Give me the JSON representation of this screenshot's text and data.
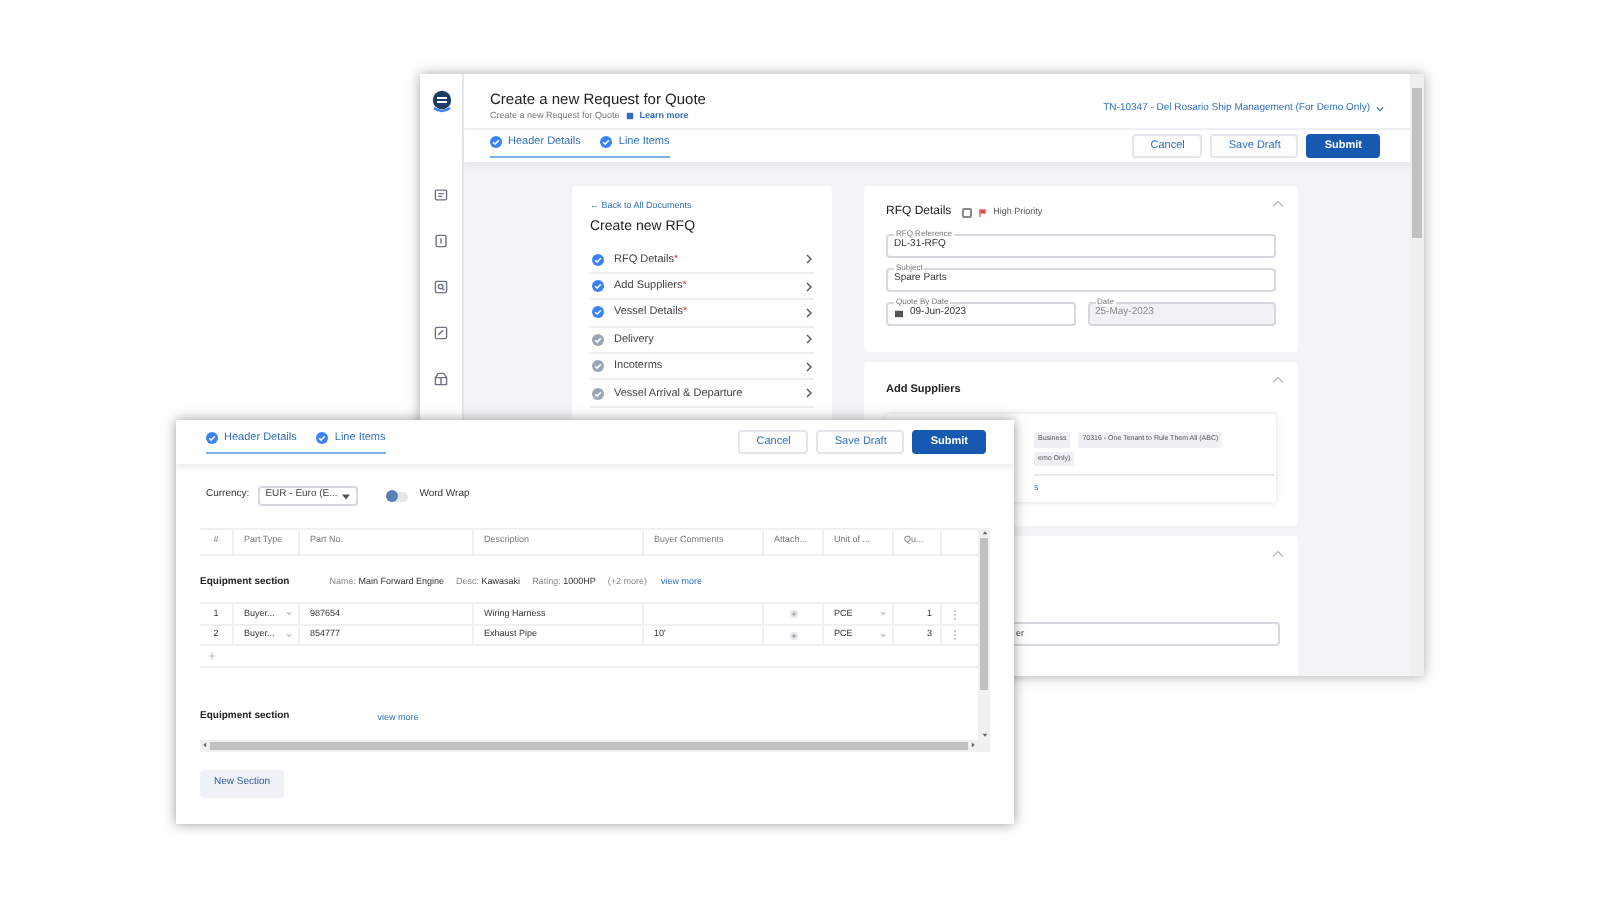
{
  "back_window": {
    "title": "Create a new Request for Quote",
    "subtitle": "Create a new Request for Quote",
    "learn_more": "Learn more",
    "account": "TN-10347 - Del Rosario Ship Management (For Demo Only)",
    "tabs": [
      {
        "label": "Header Details",
        "completed": true
      },
      {
        "label": "Line Items",
        "completed": true
      }
    ],
    "buttons": [
      {
        "label": "Cancel",
        "kind": "secondary"
      },
      {
        "label": "Save Draft",
        "kind": "secondary"
      },
      {
        "label": "Submit",
        "kind": "primary"
      }
    ],
    "steps_card": {
      "back_link": "← Back to All Documents",
      "title": "Create new RFQ",
      "steps": [
        {
          "label": "RFQ Details",
          "required_mark": "*",
          "completed": true
        },
        {
          "label": "Add Suppliers",
          "required_mark": "*",
          "completed": true
        },
        {
          "label": "Vessel Details",
          "required_mark": "*",
          "completed": true
        },
        {
          "label": "Delivery",
          "completed": false
        },
        {
          "label": "Incoterms",
          "completed": false
        },
        {
          "label": "Vessel Arrival & Departure",
          "completed": false
        }
      ]
    },
    "rfq_card": {
      "title": "RFQ Details",
      "high_priority": {
        "label": "High Priority",
        "checked": false
      },
      "fields": [
        {
          "label": "RFQ Reference",
          "value": "DL-31-RFQ",
          "kind": "text",
          "disabled": false
        },
        {
          "label": "Subject",
          "value": "Spare Parts",
          "kind": "text",
          "disabled": false
        },
        {
          "label": "Quote By Date",
          "value": "09-Jun-2023",
          "kind": "date",
          "disabled": false
        },
        {
          "label": "Date",
          "value": "25-May-2023",
          "kind": "text",
          "disabled": true
        }
      ]
    },
    "suppliers_card": {
      "title": "Add Suppliers",
      "chips": [
        "Business",
        "70316 - One Tenant to Rule Them All (ABC)"
      ],
      "chip_2": "emo Only)",
      "link": "s"
    },
    "third_card": {
      "field_value": "er"
    }
  },
  "front_window": {
    "tabs": [
      {
        "label": "Header Details",
        "completed": true
      },
      {
        "label": "Line Items",
        "completed": true
      }
    ],
    "buttons": [
      {
        "label": "Cancel",
        "kind": "secondary"
      },
      {
        "label": "Save Draft",
        "kind": "secondary"
      },
      {
        "label": "Submit",
        "kind": "primary"
      }
    ],
    "currency": {
      "label": "Currency:",
      "value": "EUR - Euro (E..."
    },
    "word_wrap": {
      "label": "Word Wrap",
      "on": false
    },
    "columns": [
      "#",
      "Part Type",
      "Part No.",
      "Description",
      "Buyer Comments",
      "Attach...",
      "Unit of ...",
      "Qu..."
    ],
    "sections": [
      {
        "title": "Equipment section",
        "meta": [
          {
            "label": "Name:",
            "value": "Main Forward Engine"
          },
          {
            "label": "Desc:",
            "value": "Kawasaki"
          },
          {
            "label": "Rating:",
            "value": "1000HP"
          }
        ],
        "more": "(+2 more)",
        "link": "view more",
        "rows": [
          {
            "cells": [
              "1",
              "Buyer...",
              "987654",
              "Wiring Harness",
              "",
              "",
              "PCE",
              "1"
            ]
          },
          {
            "cells": [
              "2",
              "Buyer...",
              "854777",
              "Exhaust Pipe",
              "10'",
              "",
              "PCE",
              "3"
            ]
          }
        ]
      },
      {
        "title": "Equipment section",
        "link": "view more"
      }
    ],
    "new_section": "New Section"
  }
}
